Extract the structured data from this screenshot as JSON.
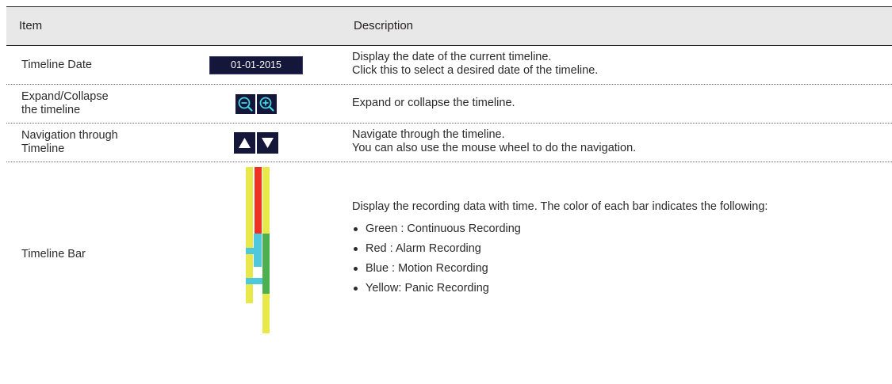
{
  "header": {
    "item_label": "Item",
    "description_label": "Description"
  },
  "rows": [
    {
      "item": "Timeline Date",
      "control": "01-01-2015",
      "description": [
        "Display the date of the current timeline.",
        "Click this to select a desired date of the timeline."
      ]
    },
    {
      "item": [
        "Expand/Collapse",
        "the timeline"
      ],
      "icons": [
        "zoom-out-icon",
        "zoom-in-icon"
      ],
      "description": [
        "Expand or collapse the timeline."
      ]
    },
    {
      "item": [
        "Navigation through",
        "Timeline"
      ],
      "icons": [
        "arrow-up-icon",
        "arrow-down-icon"
      ],
      "description": [
        "Navigate through the timeline.",
        "You can also use the mouse wheel to do the navigation."
      ]
    },
    {
      "item": "Timeline Bar",
      "description": "Display the recording data with time. The color of each bar indicates the following:",
      "legend": [
        "Green : Continuous Recording",
        "Red : Alarm Recording",
        "Blue : Motion Recording",
        "Yellow: Panic Recording"
      ]
    }
  ],
  "colors": {
    "green": "#4caf50",
    "red": "#ee3124",
    "blue": "#4fc8dc",
    "yellow": "#e8e84a",
    "button_bg": "#14163a",
    "icon_accent": "#3fd6e0"
  }
}
